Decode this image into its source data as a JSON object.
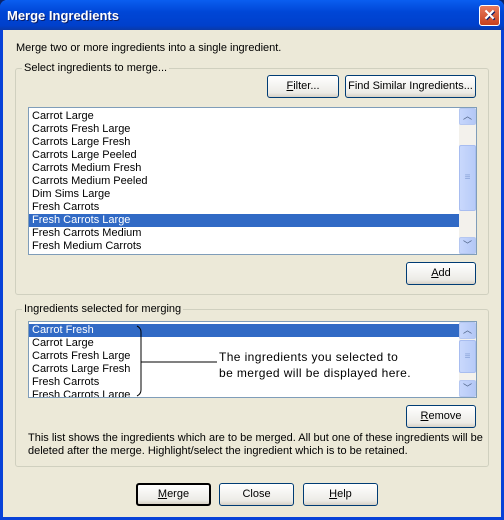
{
  "window": {
    "title": "Merge Ingredients",
    "close_icon": "close-icon"
  },
  "description": "Merge two or more ingredients into a single ingredient.",
  "select_group": {
    "legend": "Select ingredients to merge...",
    "filter_button": {
      "key": "F",
      "rest": "ilter..."
    },
    "find_similar_button": "Find Similar Ingredients...",
    "items": [
      "Carrot Large",
      "Carrots Fresh Large",
      "Carrots Large Fresh",
      "Carrots Large Peeled",
      "Carrots Medium Fresh",
      "Carrots Medium Peeled",
      "Dim Sims Large",
      "Fresh Carrots",
      "Fresh Carrots Large",
      "Fresh Carrots Medium",
      "Fresh Medium Carrots"
    ],
    "selected_index": 8,
    "add_button": {
      "key": "A",
      "rest": "dd"
    }
  },
  "merge_group": {
    "legend": "Ingredients selected for merging",
    "items": [
      "Carrot Fresh",
      "Carrot Large",
      "Carrots Fresh Large",
      "Carrots Large Fresh",
      "Fresh Carrots",
      "Fresh Carrots Large"
    ],
    "selected_index": 0,
    "annotation_line1": "The ingredients you selected to",
    "annotation_line2": "be merged will be displayed here.",
    "remove_button": {
      "key": "R",
      "rest": "emove"
    },
    "help_line1": "This list shows the ingredients which are to be merged.  All but one of these ingredients will be",
    "help_line2": "deleted after the merge.  Highlight/select the ingredient which is to be retained."
  },
  "footer": {
    "merge_button": {
      "key": "M",
      "rest": "erge"
    },
    "close_button": "Close",
    "help_button": {
      "key": "H",
      "rest": "elp"
    }
  },
  "colors": {
    "titlebar": "#0046d6",
    "selection": "#316ac5",
    "dialog_bg": "#ECE9D8"
  }
}
